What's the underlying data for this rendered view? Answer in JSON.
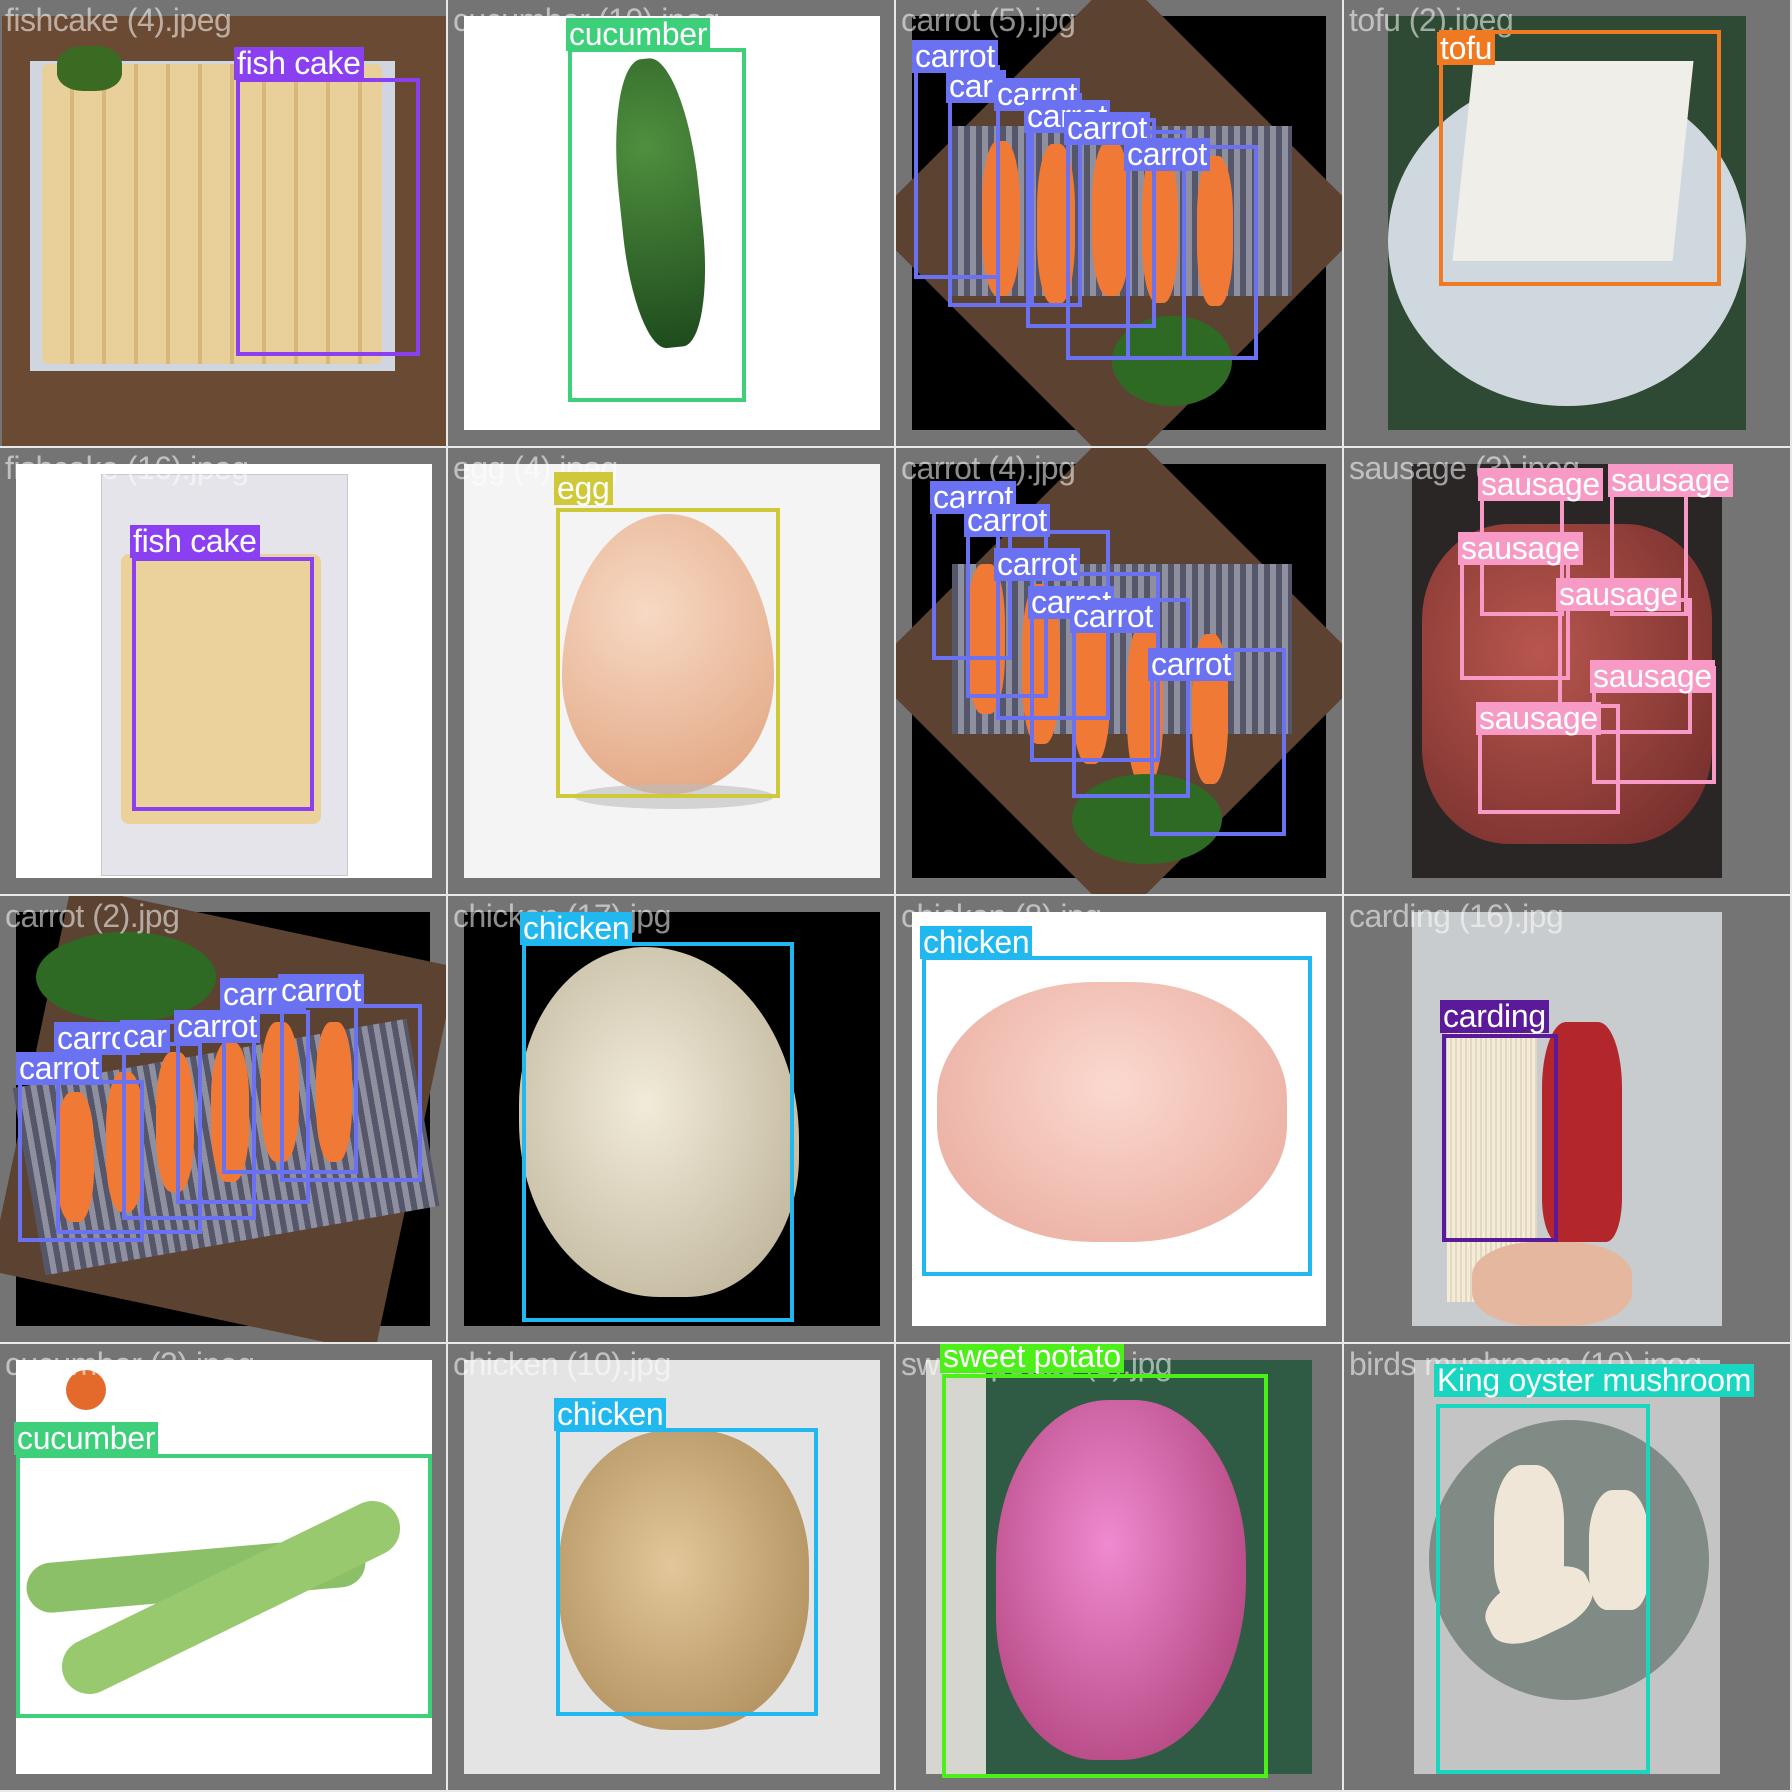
{
  "colors": {
    "fish_cake": "#8a3ff0",
    "cucumber": "#3dcf7a",
    "carrot": "#6b72f2",
    "tofu": "#ef7a22",
    "egg": "#cfc93a",
    "sausage": "#f79ac5",
    "chicken": "#21b8ef",
    "carding": "#5a1a9a",
    "sweet_potato": "#4cef18",
    "mushroom": "#18d6c0"
  },
  "cells": [
    {
      "filename": "fishcake (4).jpeg",
      "labels": [
        "fish cake"
      ]
    },
    {
      "filename": "cucumber (10).jpeg",
      "labels": [
        "cucumber"
      ]
    },
    {
      "filename": "carrot (5).jpg",
      "labels": [
        "carrot",
        "carr",
        "carrot",
        "carrot",
        "carrot",
        "carrot"
      ]
    },
    {
      "filename": "tofu (2).jpeg",
      "labels": [
        "tofu"
      ]
    },
    {
      "filename": "fishcake (16).jpeg",
      "labels": [
        "fish cake"
      ]
    },
    {
      "filename": "egg (4).jpeg",
      "labels": [
        "egg"
      ]
    },
    {
      "filename": "carrot (4).jpg",
      "labels": [
        "carrot",
        "carrot",
        "carrot",
        "carrot",
        "carrot",
        "carrot"
      ]
    },
    {
      "filename": "sausage (3).jpeg",
      "labels": [
        "sausage",
        "sausage",
        "sausage",
        "sausage",
        "sausage",
        "sausage"
      ]
    },
    {
      "filename": "carrot (2).jpg",
      "labels": [
        "carrot",
        "carrot",
        "carrot",
        "carrot",
        "car",
        "carrot"
      ]
    },
    {
      "filename": "chicken (17).jpg",
      "labels": [
        "chicken"
      ]
    },
    {
      "filename": "chicken (8).jpg",
      "labels": [
        "chicken"
      ]
    },
    {
      "filename": "carding (16).jpg",
      "labels": [
        "carding"
      ]
    },
    {
      "filename": "cucumber (3).jpeg",
      "labels": [
        "cucumber"
      ]
    },
    {
      "filename": "chicken (10).jpg",
      "labels": [
        "chicken"
      ]
    },
    {
      "filename": "sweet potato (5).jpg",
      "labels": [
        "sweet potato"
      ]
    },
    {
      "filename": "birds mushroom (10).jpeg",
      "labels": [
        "King oyster mushroom"
      ]
    }
  ]
}
